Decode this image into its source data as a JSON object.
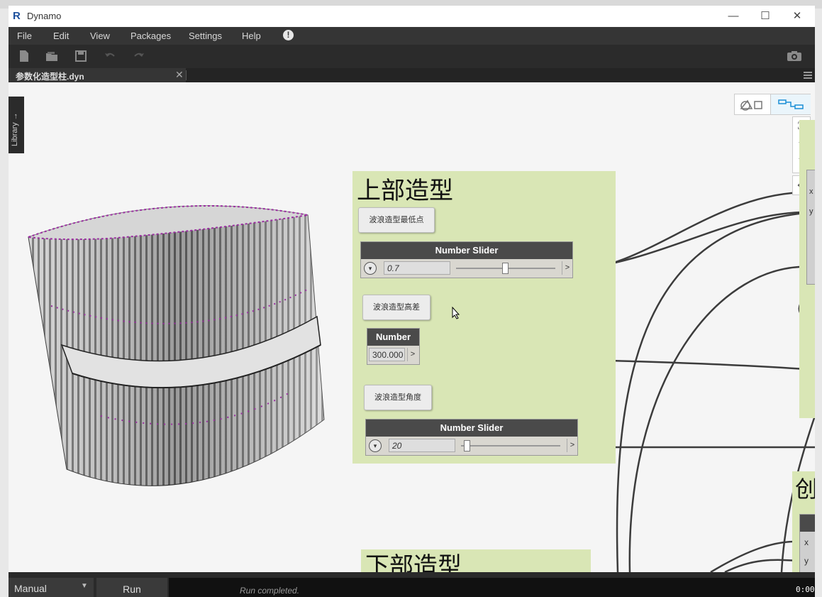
{
  "window": {
    "app_title": "Dynamo",
    "app_icon": "revit-logo-icon",
    "minimize": "—",
    "maximize": "☐",
    "close": "✕"
  },
  "menu": [
    "File",
    "Edit",
    "View",
    "Packages",
    "Settings",
    "Help"
  ],
  "tab": {
    "label": "参数化造型柱.dyn",
    "close": "✕"
  },
  "library_tab": "Library →",
  "groups": {
    "top": {
      "title": "上部造型"
    },
    "bottom": {
      "title": "下部造型"
    },
    "right_partial": {
      "title": "创"
    }
  },
  "notes": {
    "wave_lowest": "波浪造型最低点",
    "wave_height": "波浪造型高差",
    "wave_angle": "波浪造型角度"
  },
  "nodes": {
    "slider1": {
      "title": "Number Slider",
      "value": "0.7",
      "out": ">",
      "level": 0.5
    },
    "number1": {
      "title": "Number",
      "value": "300.000",
      "out": ">"
    },
    "slider2": {
      "title": "Number Slider",
      "value": "20",
      "out": ">",
      "level": 0.05
    }
  },
  "right_ports": [
    "x",
    "y",
    "x",
    "y"
  ],
  "nav": {
    "fit": "⛶",
    "zoom_in": "+",
    "zoom_out": "−",
    "pan": "✥"
  },
  "status": {
    "run_mode": "Manual",
    "run_button": "Run",
    "message": "Run completed.",
    "timer": "0:00"
  },
  "colors": {
    "canvas": "#f5f5f5",
    "group": "#d9e6b5",
    "node_header": "#4a4a4a",
    "wire": "#3c3c3c",
    "menubar": "#353535"
  }
}
